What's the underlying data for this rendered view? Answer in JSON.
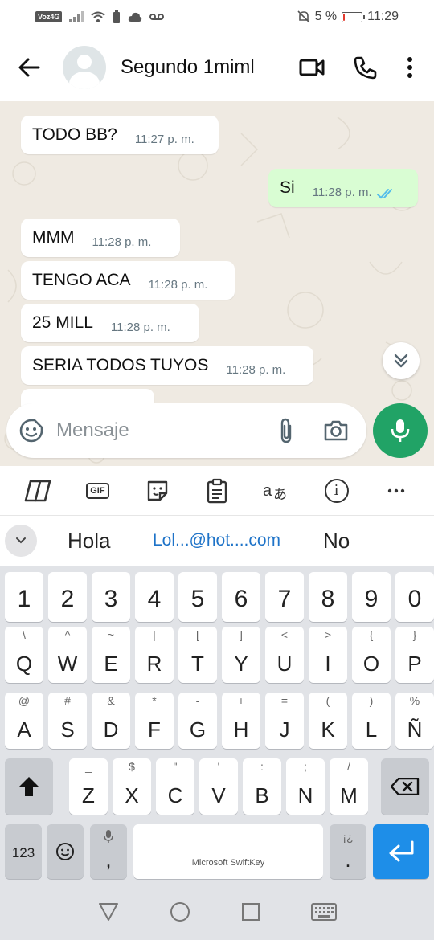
{
  "status_bar": {
    "volte": "Voz4G",
    "battery_pct_text": "5 %",
    "battery_level": 0.05,
    "time": "11:29"
  },
  "header": {
    "contact_name": "Segundo 1miml",
    "icons": [
      "back-arrow-icon",
      "video-call-icon",
      "phone-icon",
      "more-vert-icon"
    ]
  },
  "messages": [
    {
      "text": "TODO BB?",
      "time": "11:27 p. m.",
      "direction": "incoming"
    },
    {
      "text": "Si",
      "time": "11:28 p. m.",
      "direction": "outgoing",
      "status": "read"
    },
    {
      "text": "MMM",
      "time": "11:28 p. m.",
      "direction": "incoming"
    },
    {
      "text": "TENGO ACA",
      "time": "11:28 p. m.",
      "direction": "incoming"
    },
    {
      "text": "25 MILL",
      "time": "11:28 p. m.",
      "direction": "incoming"
    },
    {
      "text": "SERIA TODOS TUYOS",
      "time": "11:28 p. m.",
      "direction": "incoming"
    }
  ],
  "composer": {
    "placeholder": "Mensaje"
  },
  "suggestions": {
    "items": [
      "Hola",
      "Lol...@hot....com",
      "No"
    ]
  },
  "keyboard": {
    "number_row": [
      "1",
      "2",
      "3",
      "4",
      "5",
      "6",
      "7",
      "8",
      "9",
      "0"
    ],
    "row1": [
      {
        "main": "Q",
        "sub": "\\"
      },
      {
        "main": "W",
        "sub": "^"
      },
      {
        "main": "E",
        "sub": "~"
      },
      {
        "main": "R",
        "sub": "|"
      },
      {
        "main": "T",
        "sub": "["
      },
      {
        "main": "Y",
        "sub": "]"
      },
      {
        "main": "U",
        "sub": "<"
      },
      {
        "main": "I",
        "sub": ">"
      },
      {
        "main": "O",
        "sub": "{"
      },
      {
        "main": "P",
        "sub": "}"
      }
    ],
    "row2": [
      {
        "main": "A",
        "sub": "@"
      },
      {
        "main": "S",
        "sub": "#"
      },
      {
        "main": "D",
        "sub": "&"
      },
      {
        "main": "F",
        "sub": "*"
      },
      {
        "main": "G",
        "sub": "-"
      },
      {
        "main": "H",
        "sub": "+"
      },
      {
        "main": "J",
        "sub": "="
      },
      {
        "main": "K",
        "sub": "("
      },
      {
        "main": "L",
        "sub": ")"
      },
      {
        "main": "Ñ",
        "sub": "%"
      }
    ],
    "row3": [
      {
        "main": "Z",
        "sub": "_"
      },
      {
        "main": "X",
        "sub": "$"
      },
      {
        "main": "C",
        "sub": "\""
      },
      {
        "main": "V",
        "sub": "'"
      },
      {
        "main": "B",
        "sub": ":"
      },
      {
        "main": "N",
        "sub": ";"
      },
      {
        "main": "M",
        "sub": "/"
      }
    ],
    "symbols_label": "123",
    "comma": {
      "main": ",",
      "sub": "mic"
    },
    "space_label": "Microsoft SwiftKey",
    "period": {
      "main": ".",
      "sub": "¡¿"
    }
  },
  "colors": {
    "accent_green": "#21a366",
    "outgoing_bubble": "#d9fdd3",
    "chat_bg": "#efeae2",
    "enter_key": "#1e8ee8",
    "read_ticks": "#53bdeb"
  }
}
